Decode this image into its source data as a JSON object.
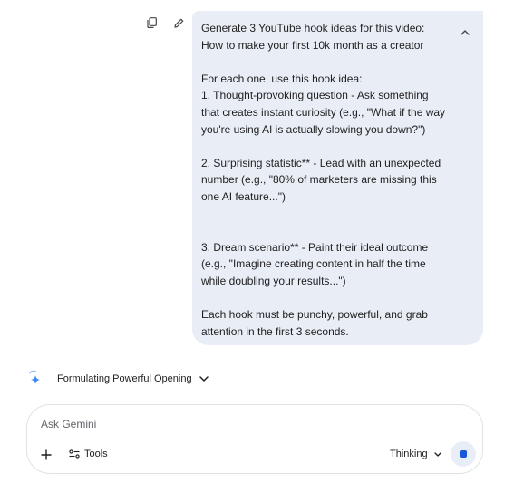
{
  "message": {
    "text": "Generate 3 YouTube hook ideas for this video: How to make your first 10k month as a creator\n\nFor each one, use this hook idea:\n1. Thought-provoking question - Ask something that creates instant curiosity (e.g., \"What if the way you're using AI is actually slowing you down?\")\n\n2. Surprising statistic** - Lead with an unexpected number (e.g., \"80% of marketers are missing this one AI feature...\")\n\n\n3. Dream scenario** - Paint their ideal outcome (e.g., \"Imagine creating content in half the time while doubling your results...\")\n\nEach hook must be punchy, powerful, and grab attention in the first 3 seconds.",
    "actions": [
      "copy-icon",
      "edit-icon"
    ],
    "collapse_icon": "chevron-up-icon"
  },
  "thinking": {
    "label": "Formulating Powerful Opening",
    "icon": "gemini-spark-icon",
    "accent": "#4285f4"
  },
  "composer": {
    "placeholder": "Ask Gemini",
    "tools_label": "Tools",
    "mode_label": "Thinking",
    "stop_color": "#1a57d8"
  }
}
